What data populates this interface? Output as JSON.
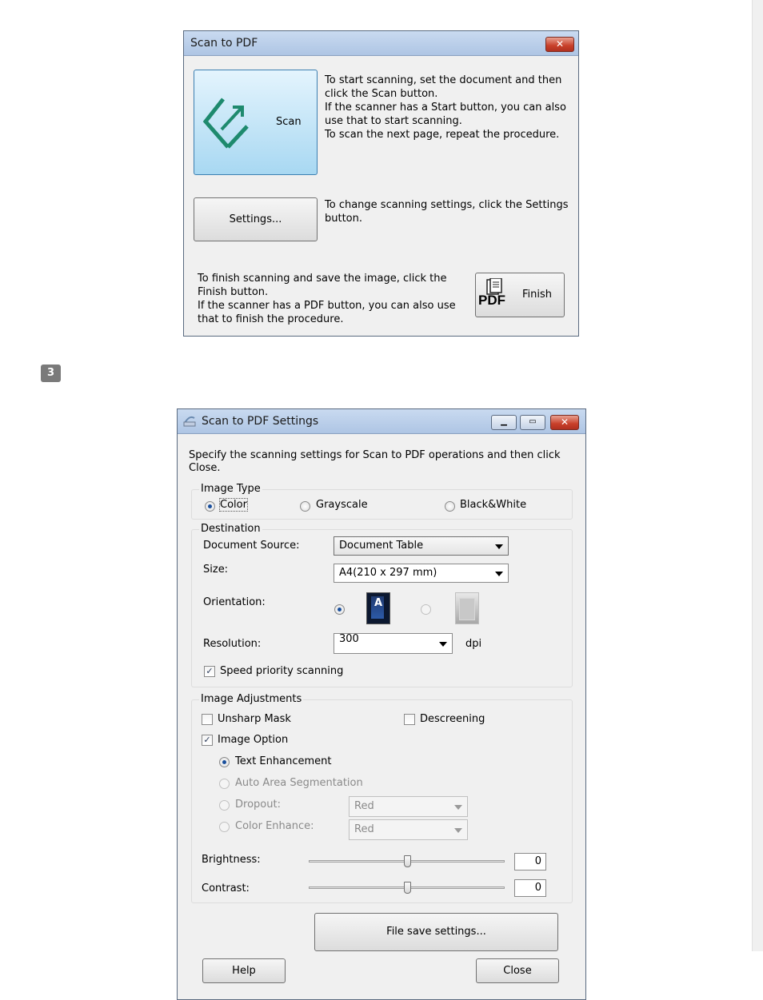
{
  "scan_dialog": {
    "title": "Scan to PDF",
    "close_label": "✕",
    "scan_label": "Scan",
    "scan_text": [
      "To start scanning, set the document and then",
      "click the Scan button.",
      "If the scanner has a Start button, you can also",
      "use that to start scanning.",
      "To scan the next page, repeat the procedure."
    ],
    "settings_label": "Settings...",
    "settings_text": [
      "To change scanning settings, click the Settings",
      "button."
    ],
    "finish_text": [
      "To finish scanning and save the image, click the",
      "Finish button.",
      "If the scanner has a PDF button, you can also use",
      "that to finish the procedure."
    ],
    "finish_label": "Finish",
    "pdf_icon_label": "PDF"
  },
  "step_number": "3",
  "settings_dialog": {
    "title": "Scan to PDF Settings",
    "intro": [
      "Specify the scanning settings for Scan to PDF operations and then click",
      "Close."
    ],
    "image_type": {
      "label": "Image Type",
      "options": [
        "Color",
        "Grayscale",
        "Black&White"
      ],
      "selected": "Color"
    },
    "destination": {
      "label": "Destination",
      "document_source_label": "Document Source:",
      "document_source_value": "Document Table",
      "size_label": "Size:",
      "size_value": "A4(210 x 297 mm)",
      "orientation_label": "Orientation:",
      "orientation_selected": "portrait",
      "resolution_label": "Resolution:",
      "resolution_value": "300",
      "resolution_unit": "dpi",
      "speed_priority_label": "Speed priority scanning",
      "speed_priority_checked": true
    },
    "image_adjustments": {
      "label": "Image Adjustments",
      "unsharp_mask_label": "Unsharp Mask",
      "unsharp_mask_checked": false,
      "descreening_label": "Descreening",
      "descreening_checked": false,
      "image_option_label": "Image Option",
      "image_option_checked": true,
      "text_enhancement_label": "Text Enhancement",
      "auto_area_label": "Auto Area Segmentation",
      "dropout_label": "Dropout:",
      "dropout_value": "Red",
      "color_enhance_label": "Color Enhance:",
      "color_enhance_value": "Red",
      "brightness_label": "Brightness:",
      "brightness_value": "0",
      "contrast_label": "Contrast:",
      "contrast_value": "0"
    },
    "file_save_label": "File save settings...",
    "help_label": "Help",
    "close_label": "Close"
  },
  "colors": {
    "titlebar": "#b8cde9",
    "close_red": "#c8402a",
    "scan_blue": "#a8d8f2",
    "radio_dot": "#1a4f9c"
  }
}
